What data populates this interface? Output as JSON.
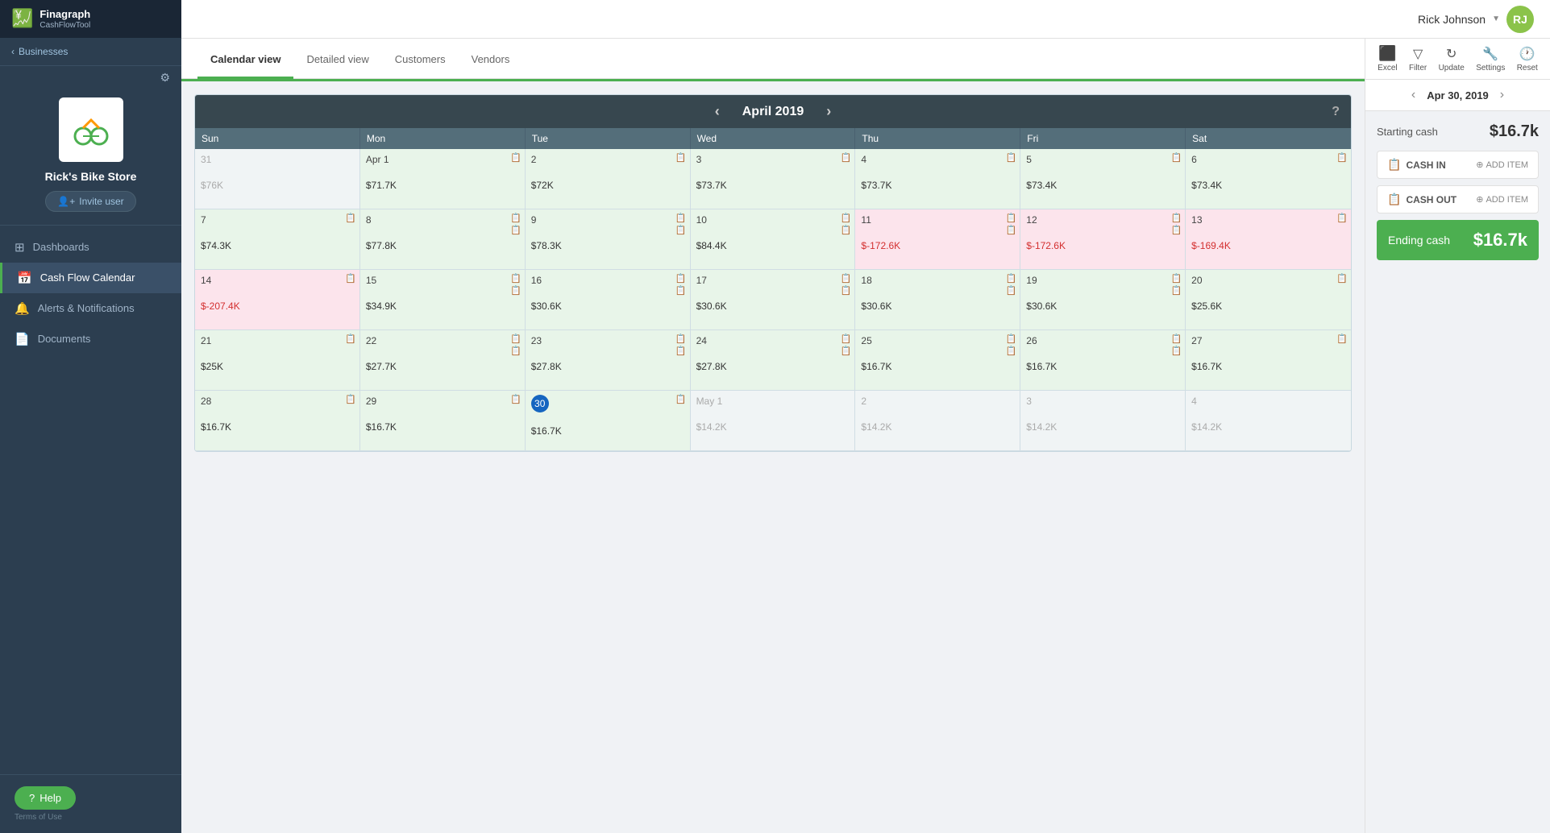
{
  "app": {
    "name": "Finagraph",
    "subname": "CashFlowTool"
  },
  "user": {
    "name": "Rick Johnson",
    "initials": "RJ"
  },
  "sidebar": {
    "back_label": "Businesses",
    "business_name": "Rick's Bike Store",
    "invite_label": "Invite user",
    "settings_icon": "⚙",
    "nav": [
      {
        "id": "dashboards",
        "label": "Dashboards",
        "icon": "⊞",
        "active": false
      },
      {
        "id": "cash-flow-calendar",
        "label": "Cash Flow Calendar",
        "icon": "📅",
        "active": true
      },
      {
        "id": "alerts",
        "label": "Alerts & Notifications",
        "icon": "🔔",
        "active": false
      },
      {
        "id": "documents",
        "label": "Documents",
        "icon": "📄",
        "active": false
      }
    ],
    "help_label": "Help",
    "terms_label": "Terms of Use"
  },
  "tabs": [
    {
      "id": "calendar-view",
      "label": "Calendar view",
      "active": true
    },
    {
      "id": "detailed-view",
      "label": "Detailed view",
      "active": false
    },
    {
      "id": "customers",
      "label": "Customers",
      "active": false
    },
    {
      "id": "vendors",
      "label": "Vendors",
      "active": false
    }
  ],
  "calendar": {
    "month": "April 2019",
    "day_headers": [
      "Sun",
      "Mon",
      "Tue",
      "Wed",
      "Thu",
      "Fri",
      "Sat"
    ],
    "weeks": [
      [
        {
          "day": "31",
          "label": "",
          "amount": "$76K",
          "other": true,
          "negative": false
        },
        {
          "day": "Apr 1",
          "label": "",
          "amount": "$71.7K",
          "other": false,
          "negative": false
        },
        {
          "day": "2",
          "label": "",
          "amount": "$72K",
          "other": false,
          "negative": false
        },
        {
          "day": "3",
          "label": "",
          "amount": "$73.7K",
          "other": false,
          "negative": false
        },
        {
          "day": "4",
          "label": "",
          "amount": "$73.7K",
          "other": false,
          "negative": false
        },
        {
          "day": "5",
          "label": "",
          "amount": "$73.4K",
          "other": false,
          "negative": false
        },
        {
          "day": "6",
          "label": "",
          "amount": "$73.4K",
          "other": false,
          "negative": false
        }
      ],
      [
        {
          "day": "7",
          "label": "",
          "amount": "$74.3K",
          "other": false,
          "negative": false
        },
        {
          "day": "8",
          "label": "",
          "amount": "$77.8K",
          "other": false,
          "negative": false
        },
        {
          "day": "9",
          "label": "",
          "amount": "$78.3K",
          "other": false,
          "negative": false
        },
        {
          "day": "10",
          "label": "",
          "amount": "$84.4K",
          "other": false,
          "negative": false
        },
        {
          "day": "11",
          "label": "",
          "amount": "$-172.6K",
          "other": false,
          "negative": true
        },
        {
          "day": "12",
          "label": "",
          "amount": "$-172.6K",
          "other": false,
          "negative": true
        },
        {
          "day": "13",
          "label": "",
          "amount": "$-169.4K",
          "other": false,
          "negative": true
        }
      ],
      [
        {
          "day": "14",
          "label": "",
          "amount": "$-207.4K",
          "other": false,
          "negative": true
        },
        {
          "day": "15",
          "label": "",
          "amount": "$34.9K",
          "other": false,
          "negative": false
        },
        {
          "day": "16",
          "label": "",
          "amount": "$30.6K",
          "other": false,
          "negative": false
        },
        {
          "day": "17",
          "label": "",
          "amount": "$30.6K",
          "other": false,
          "negative": false
        },
        {
          "day": "18",
          "label": "",
          "amount": "$30.6K",
          "other": false,
          "negative": false
        },
        {
          "day": "19",
          "label": "",
          "amount": "$30.6K",
          "other": false,
          "negative": false
        },
        {
          "day": "20",
          "label": "",
          "amount": "$25.6K",
          "other": false,
          "negative": false
        }
      ],
      [
        {
          "day": "21",
          "label": "",
          "amount": "$25K",
          "other": false,
          "negative": false
        },
        {
          "day": "22",
          "label": "",
          "amount": "$27.7K",
          "other": false,
          "negative": false
        },
        {
          "day": "23",
          "label": "",
          "amount": "$27.8K",
          "other": false,
          "negative": false
        },
        {
          "day": "24",
          "label": "",
          "amount": "$27.8K",
          "other": false,
          "negative": false
        },
        {
          "day": "25",
          "label": "",
          "amount": "$16.7K",
          "other": false,
          "negative": false
        },
        {
          "day": "26",
          "label": "",
          "amount": "$16.7K",
          "other": false,
          "negative": false
        },
        {
          "day": "27",
          "label": "",
          "amount": "$16.7K",
          "other": false,
          "negative": false
        }
      ],
      [
        {
          "day": "28",
          "label": "",
          "amount": "$16.7K",
          "other": false,
          "negative": false
        },
        {
          "day": "29",
          "label": "",
          "amount": "$16.7K",
          "other": false,
          "negative": false
        },
        {
          "day": "30",
          "label": "",
          "amount": "$16.7K",
          "other": false,
          "negative": false,
          "today": true,
          "selected": true
        },
        {
          "day": "May 1",
          "label": "",
          "amount": "$14.2K",
          "other": true,
          "negative": false
        },
        {
          "day": "2",
          "label": "",
          "amount": "$14.2K",
          "other": true,
          "negative": false
        },
        {
          "day": "3",
          "label": "",
          "amount": "$14.2K",
          "other": true,
          "negative": false
        },
        {
          "day": "4",
          "label": "",
          "amount": "$14.2K",
          "other": true,
          "negative": false
        }
      ]
    ]
  },
  "right_panel": {
    "toolbar": [
      {
        "id": "excel",
        "icon": "📊",
        "label": "Excel"
      },
      {
        "id": "filter",
        "icon": "🔽",
        "label": "Filter"
      },
      {
        "id": "update",
        "icon": "🔄",
        "label": "Update"
      },
      {
        "id": "settings",
        "icon": "🔧",
        "label": "Settings"
      },
      {
        "id": "reset",
        "icon": "🕐",
        "label": "Reset"
      }
    ],
    "date_nav": {
      "label": "Apr 30, 2019"
    },
    "starting_cash_label": "Starting cash",
    "starting_cash_value": "$16.7k",
    "cash_in_label": "CASH IN",
    "cash_out_label": "CASH OUT",
    "add_item_label": "ADD ITEM",
    "ending_cash_label": "Ending cash",
    "ending_cash_value": "$16.7k"
  }
}
